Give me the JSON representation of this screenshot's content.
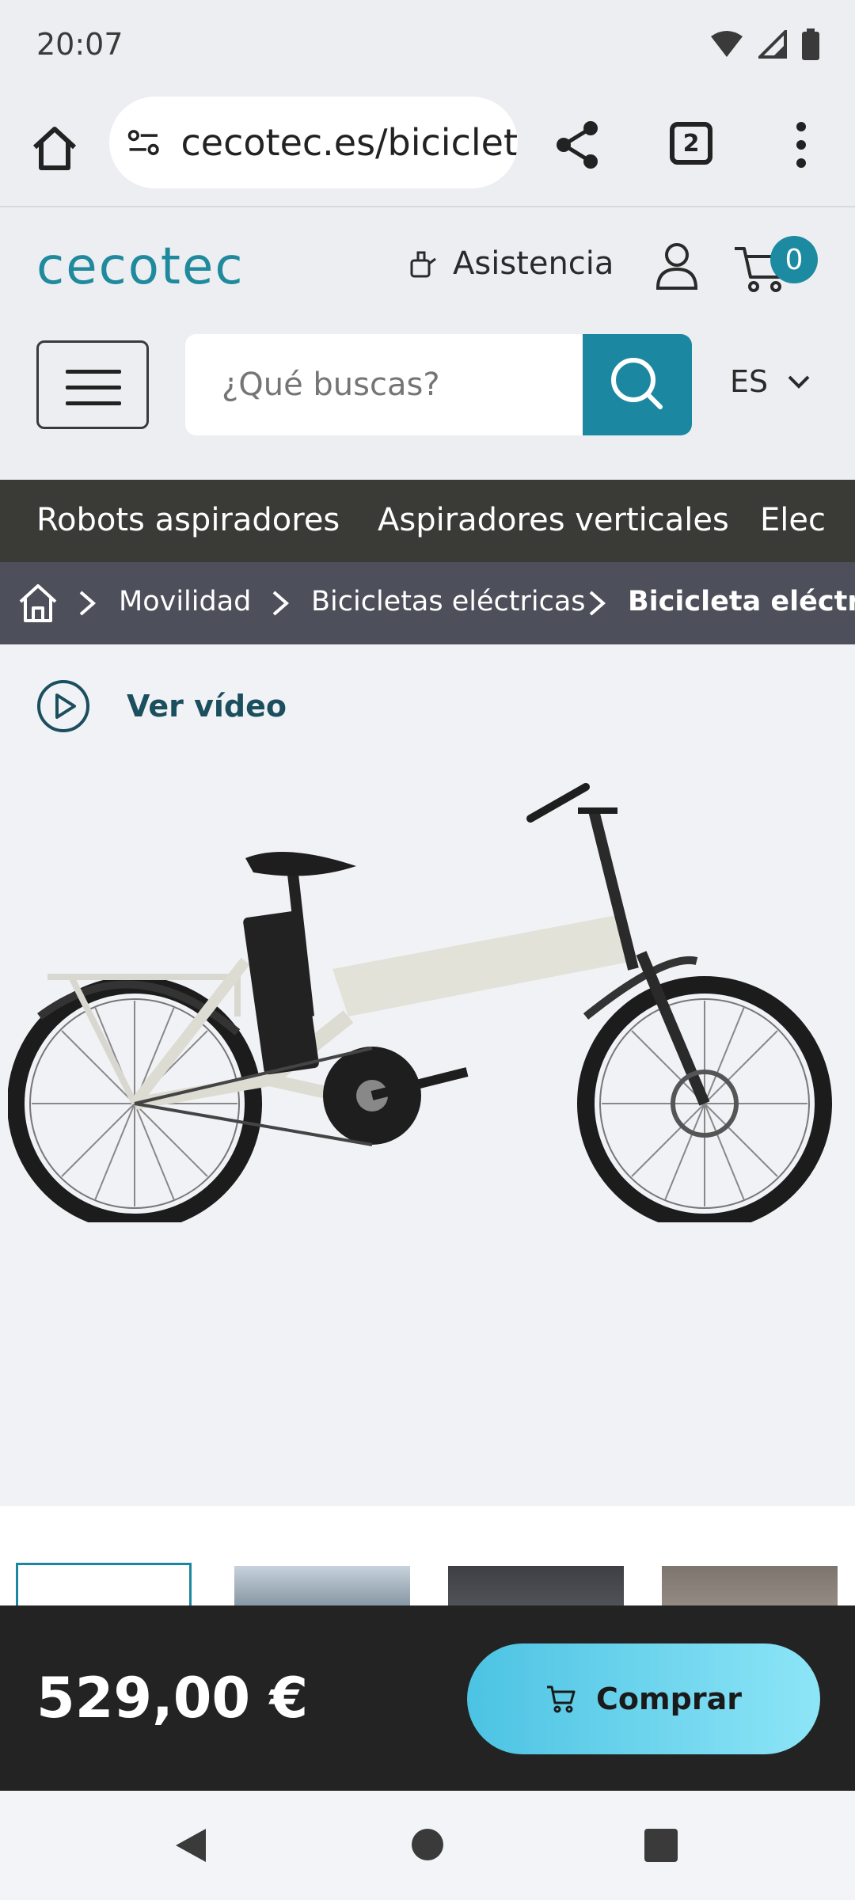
{
  "status_bar": {
    "time": "20:07"
  },
  "browser": {
    "url": "cecotec.es/biciclet",
    "tab_count": "2"
  },
  "header": {
    "logo_text": "cecotec",
    "assist_label": "Asistencia",
    "cart_count": "0",
    "search_placeholder": "¿Qué buscas?",
    "language": "ES"
  },
  "categories": [
    "Robots aspiradores",
    "Aspiradores verticales",
    "Elec"
  ],
  "breadcrumb": [
    "Movilidad",
    "Bicicletas eléctricas",
    "Bicicleta eléctr"
  ],
  "product": {
    "video_label": "Ver vídeo"
  },
  "buy_bar": {
    "price": "529,00 €",
    "buy_label": "Comprar"
  },
  "colors": {
    "brand": "#1c87a0",
    "nav_dark": "#3a3a36",
    "breadcrumb_bg": "#4d505a",
    "buy_bar_bg": "#232323"
  }
}
